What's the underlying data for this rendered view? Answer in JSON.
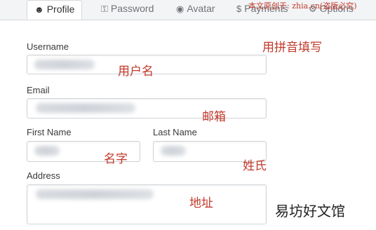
{
  "tabs": [
    {
      "label": "Profile",
      "icon": "user-icon",
      "glyph": "☻"
    },
    {
      "label": "Password",
      "icon": "key-icon",
      "glyph": "⚿"
    },
    {
      "label": "Avatar",
      "icon": "avatar-icon",
      "glyph": "◉"
    },
    {
      "label": "Payments",
      "icon": "dollar-icon",
      "glyph": "$"
    },
    {
      "label": "Options",
      "icon": "gear-icon",
      "glyph": "⚙"
    }
  ],
  "watermark": "本文原创于: zhia.cn(盗版必究)",
  "form": {
    "username": {
      "label": "Username",
      "note": "用户名",
      "hint": "用拼音填写"
    },
    "email": {
      "label": "Email",
      "note": "邮箱"
    },
    "first_name": {
      "label": "First Name",
      "note": "名字"
    },
    "last_name": {
      "label": "Last Name",
      "note": "姓氏"
    },
    "address": {
      "label": "Address",
      "note": "地址"
    }
  },
  "brand_watermark": "易坊好文馆",
  "colors": {
    "annotation": "#c0392b",
    "border": "#cfd3d7",
    "tab_bar": "#f3f4f6"
  }
}
